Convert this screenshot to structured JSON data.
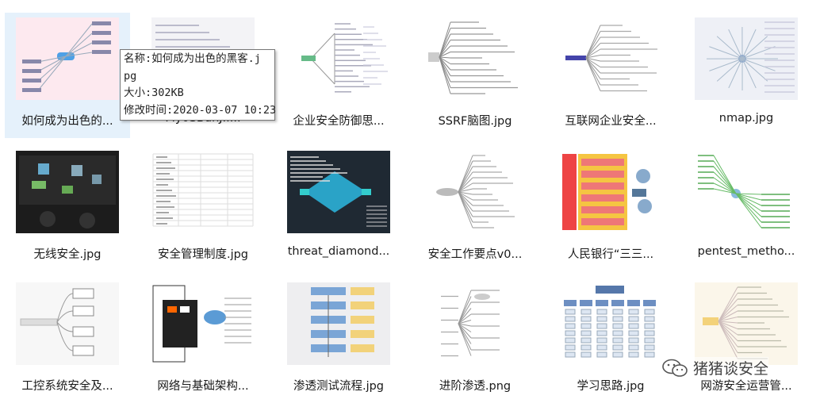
{
  "files": [
    {
      "label": "如何成为出色的..."
    },
    {
      "label": "My0SBdhJ....."
    },
    {
      "label": "企业安全防御思..."
    },
    {
      "label": "SSRF脑图.jpg"
    },
    {
      "label": "互联网企业安全..."
    },
    {
      "label": "nmap.jpg"
    },
    {
      "label": "无线安全.jpg"
    },
    {
      "label": "安全管理制度.jpg"
    },
    {
      "label": "threat_diamond..."
    },
    {
      "label": "安全工作要点v0..."
    },
    {
      "label": "人民银行“三三..."
    },
    {
      "label": "pentest_metho..."
    },
    {
      "label": "工控系统安全及..."
    },
    {
      "label": "网络与基础架构..."
    },
    {
      "label": "渗透测试流程.jpg"
    },
    {
      "label": "进阶渗透.png"
    },
    {
      "label": "学习思路.jpg"
    },
    {
      "label": "网游安全运营管..."
    }
  ],
  "tooltip": {
    "name": "名称:如何成为出色的黑客.j",
    "name_cont": "pg",
    "size": "大小:302KB",
    "modified": "修改时间:2020-03-07 10:23"
  },
  "watermark": {
    "text": "猪猪谈安全",
    "icon": "wechat-icon"
  },
  "colors": {
    "selection": "#e5f1fb",
    "tooltip_border": "#767676"
  }
}
